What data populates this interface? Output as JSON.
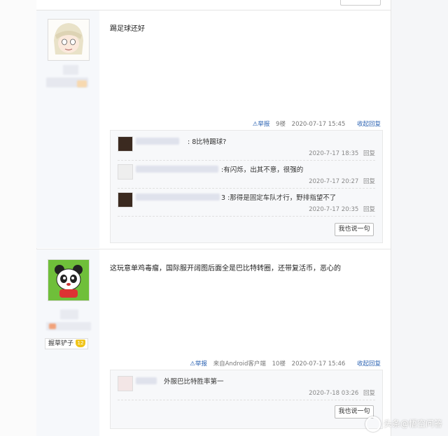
{
  "posts": [
    {
      "text": "踢足球还好",
      "tail": {
        "report": "举报",
        "floor": "9楼",
        "time": "2020-07-17 15:45",
        "action": "收起回复"
      },
      "replies": [
        {
          "text": ": 8比特踢球?",
          "time": "2020-7-17 18:35",
          "reply": "回复"
        },
        {
          "text": ":有闪烁，出其不意，很强的",
          "time": "2020-7-17 20:27",
          "reply": "回复"
        },
        {
          "text": "3 :那得是固定车队才行，野排指望不了",
          "time": "2020-7-17 20:35",
          "reply": "回复"
        }
      ],
      "say_button": "我也说一句"
    },
    {
      "text": "这玩意单鸡毒瘤，国际服开阔图后面全是巴比特转圈，还带复活币，恶心的",
      "badge": {
        "name": "握草铲子",
        "level": "12"
      },
      "tail": {
        "report": "举报",
        "source": "来自Android客户端",
        "floor": "10楼",
        "time": "2020-07-17 15:46",
        "action": "收起回复"
      },
      "replies": [
        {
          "text": "外服巴比特胜率第一",
          "time": "2020-7-18 03:26",
          "reply": "回复"
        }
      ],
      "say_button": "我也说一句"
    }
  ],
  "watermark": "头条@悟空问答"
}
